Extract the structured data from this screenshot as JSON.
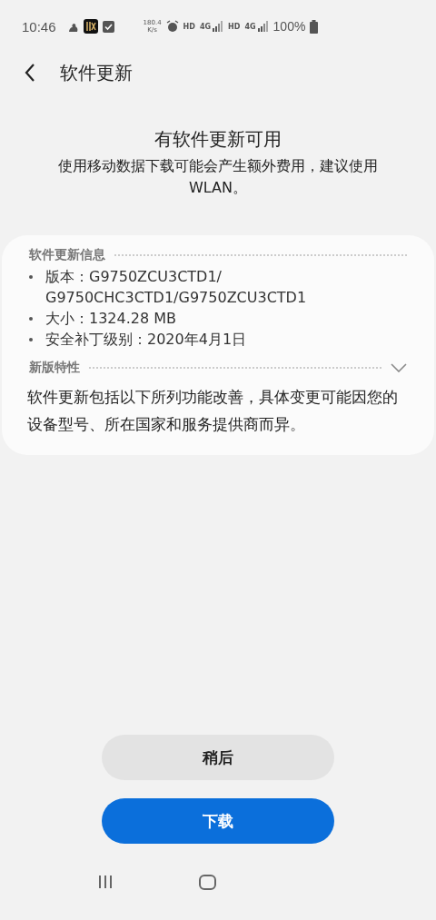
{
  "status_bar": {
    "time": "10:46",
    "speed_value": "180.4",
    "speed_unit": "K/s",
    "network": [
      {
        "hd": "HD",
        "type": "4G"
      },
      {
        "hd": "HD",
        "type": "4G"
      }
    ],
    "battery": "100%"
  },
  "header": {
    "title": "软件更新"
  },
  "notice": {
    "title": "有软件更新可用",
    "message": "使用移动数据下载可能会产生额外费用，建议使用 WLAN。"
  },
  "info": {
    "heading": "软件更新信息",
    "items": [
      {
        "label": "版本：",
        "value_lines": [
          "G9750ZCU3CTD1/",
          "G9750CHC3CTD1/G9750ZCU3CTD1"
        ]
      },
      {
        "label": "大小：",
        "value_lines": [
          "1324.28 MB"
        ]
      },
      {
        "label": "安全补丁级别：",
        "value_lines": [
          "2020年4月1日"
        ]
      }
    ]
  },
  "features": {
    "heading": "新版特性",
    "text": "软件更新包括以下所列功能改善，具体变更可能因您的设备型号、所在国家和服务提供商而异。"
  },
  "buttons": [
    {
      "label": "稍后",
      "kind": "secondary"
    },
    {
      "label": "下载",
      "kind": "primary"
    }
  ]
}
